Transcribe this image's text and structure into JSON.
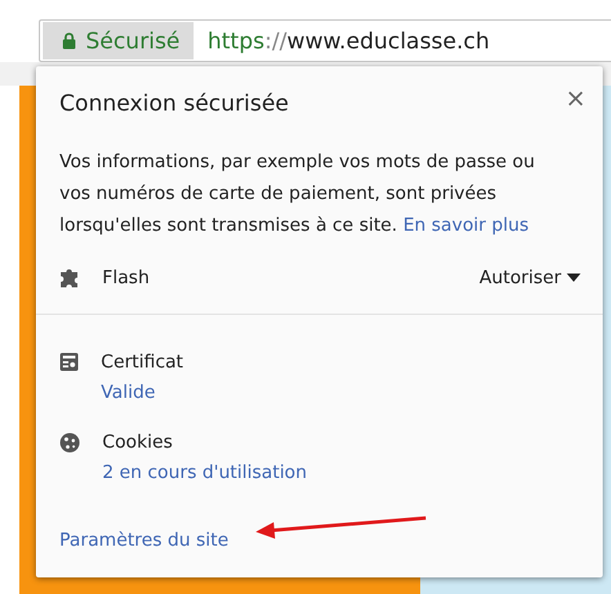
{
  "address_bar": {
    "security_chip": "Sécurisé",
    "url": {
      "scheme": "https",
      "separator": "://",
      "host": "www.educlasse.ch"
    }
  },
  "popup": {
    "title": "Connexion sécurisée",
    "close": "×",
    "description": "Vos informations, par exemple vos mots de passe ou vos numéros de carte de paiement, sont privées lorsqu'elles sont transmises à ce site.",
    "learn_more": "En savoir plus",
    "permissions": [
      {
        "name": "Flash",
        "value": "Autoriser"
      }
    ],
    "items": [
      {
        "kind": "certificate",
        "title": "Certificat",
        "detail": "Valide"
      },
      {
        "kind": "cookies",
        "title": "Cookies",
        "detail": "2 en cours d'utilisation"
      }
    ],
    "site_settings": "Paramètres du site"
  }
}
